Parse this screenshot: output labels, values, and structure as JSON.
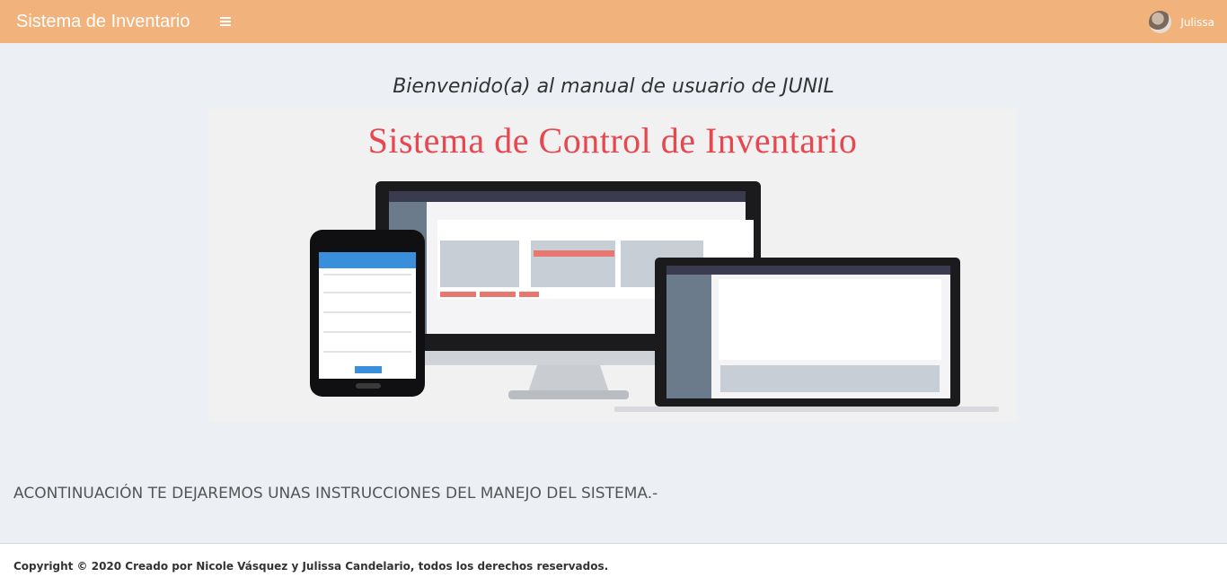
{
  "header": {
    "brand": "Sistema de Inventario",
    "menu_icon": "bars-icon",
    "user_name": "Julissa"
  },
  "main": {
    "welcome": "Bienvenido(a) al manual de usuario de JUNIL",
    "banner_title": "Sistema de Control de Inventario",
    "instructions": "ACONTINUACIÓN TE DEJAREMOS UNAS INSTRUCCIONES DEL MANEJO DEL SISTEMA.-"
  },
  "footer": {
    "copyright": "Copyright © 2020 Creado por Nicole Vásquez y Julissa Candelario, todos los derechos reservados."
  },
  "colors": {
    "navbar": "#f2b27b",
    "page_background": "#ecf0f5",
    "banner_title": "#e8474f"
  }
}
